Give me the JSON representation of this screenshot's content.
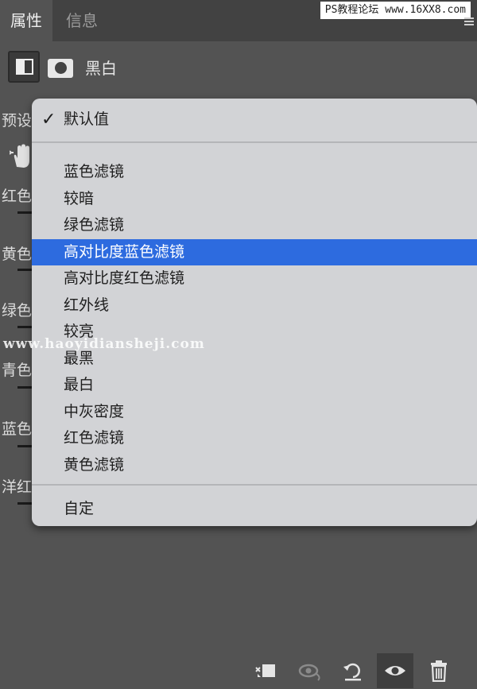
{
  "tabs": {
    "active": "属性",
    "inactive": "信息"
  },
  "watermark_top": "PS教程论坛 www.16XX8.com",
  "panel": {
    "adjustment_title": "黑白",
    "preset_label": "预设"
  },
  "side_labels": [
    "红色",
    "黄色",
    "绿色",
    "青色",
    "蓝色",
    "洋红"
  ],
  "dropdown": {
    "default_item": "默认值",
    "items": [
      "蓝色滤镜",
      "较暗",
      "绿色滤镜",
      "高对比度蓝色滤镜",
      "高对比度红色滤镜",
      "红外线",
      "较亮",
      "最黑",
      "最白",
      "中灰密度",
      "红色滤镜",
      "黄色滤镜"
    ],
    "selected_item": "高对比度蓝色滤镜",
    "custom_item": "自定"
  },
  "watermark_mid": "www.haoyidiansheji.com",
  "colors": {
    "selected": "#2d6bdf",
    "dropdown_bg": "#d2d3d6",
    "panel_bg": "#535353"
  },
  "icons": [
    "black-white-adjustment-icon",
    "mask-icon",
    "targeted-adjust-hand-icon",
    "clip-to-layer-icon",
    "view-previous-state-icon",
    "reset-icon",
    "visibility-eye-icon",
    "trash-icon"
  ]
}
